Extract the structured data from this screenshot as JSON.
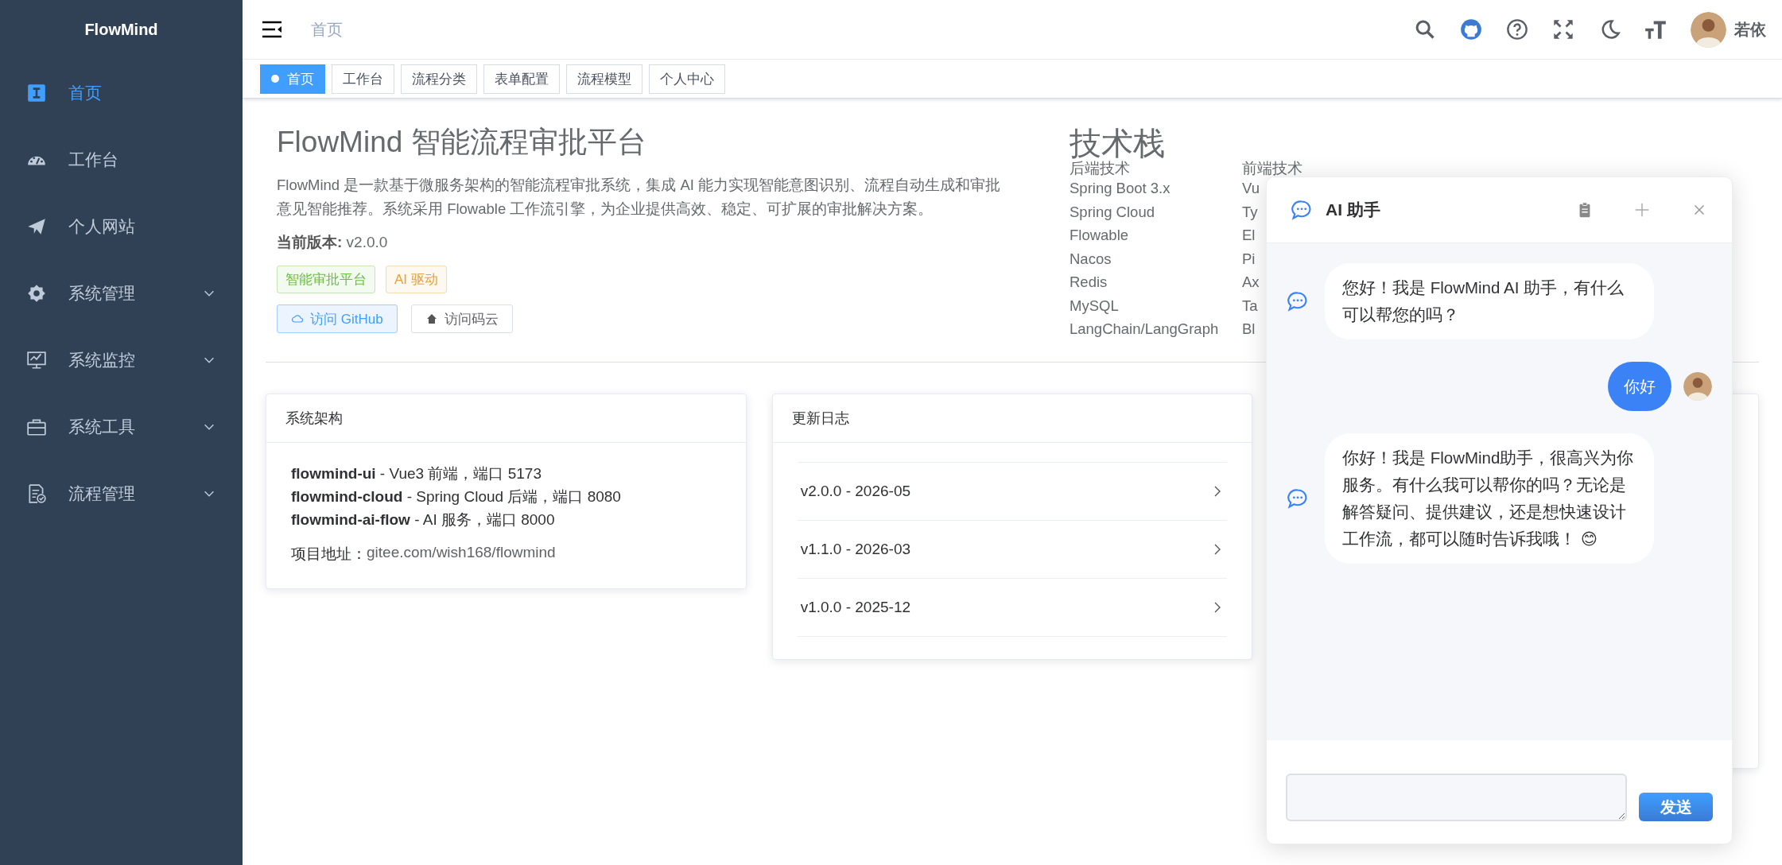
{
  "sidebar": {
    "logo": "FlowMind",
    "items": [
      {
        "label": "首页",
        "selected": true,
        "expandable": false
      },
      {
        "label": "工作台",
        "selected": false,
        "expandable": false
      },
      {
        "label": "个人网站",
        "selected": false,
        "expandable": false
      },
      {
        "label": "系统管理",
        "selected": false,
        "expandable": true
      },
      {
        "label": "系统监控",
        "selected": false,
        "expandable": true
      },
      {
        "label": "系统工具",
        "selected": false,
        "expandable": true
      },
      {
        "label": "流程管理",
        "selected": false,
        "expandable": true
      }
    ]
  },
  "header": {
    "breadcrumb": "首页",
    "user": "若依"
  },
  "tags": [
    {
      "label": "首页",
      "selected": true
    },
    {
      "label": "工作台",
      "selected": false
    },
    {
      "label": "流程分类",
      "selected": false
    },
    {
      "label": "表单配置",
      "selected": false
    },
    {
      "label": "流程模型",
      "selected": false
    },
    {
      "label": "个人中心",
      "selected": false
    }
  ],
  "intro": {
    "title": "FlowMind 智能流程审批平台",
    "description": "FlowMind 是一款基于微服务架构的智能流程审批系统，集成 AI 能力实现智能意图识别、流程自动生成和审批意见智能推荐。系统采用 Flowable 工作流引擎，为企业提供高效、稳定、可扩展的审批解决方案。",
    "version": "**当前版本:** v2.0.0",
    "tags": [
      {
        "label": "智能审批平台",
        "color": "#67c23a"
      },
      {
        "label": "AI 驱动",
        "color": "#e6a23c"
      }
    ],
    "buttons": [
      {
        "label": "访问 GitHub",
        "kind": "primary"
      },
      {
        "label": "访问码云",
        "kind": "default"
      }
    ]
  },
  "tech_stack": {
    "title": "技术栈",
    "columns": [
      {
        "heading": "后端技术",
        "items": [
          "Spring Boot 3.x",
          "Spring Cloud",
          "Flowable",
          "Nacos",
          "Redis",
          "MySQL",
          "LangChain/LangGraph"
        ]
      },
      {
        "heading": "前端技术",
        "items": [
          "Vu",
          "Ty",
          "El",
          "Pi",
          "Ax",
          "Ta",
          "Bl"
        ]
      }
    ]
  },
  "architecture": {
    "title": "系统架构",
    "lines": [
      "**flowmind-ui** - Vue3 前端，端口 5173",
      "**flowmind-cloud** - Spring Cloud 后端，端口 8080",
      "**flowmind-ai-flow** - AI 服务，端口 8000"
    ],
    "address_label": "项目地址：",
    "address": "gitee.com/wish168/flowmind"
  },
  "changelog": {
    "title": "更新日志",
    "entries": [
      "v2.0.0 - 2026-05",
      "v1.1.0 - 2026-03",
      "v1.0.0 - 2025-12"
    ]
  },
  "chat": {
    "title": "AI 助手",
    "messages": [
      {
        "kind": "assistant",
        "text": "您好！我是 FlowMind AI 助手，有什么可以帮您的吗？"
      },
      {
        "kind": "user",
        "text": "你好"
      },
      {
        "kind": "assistant",
        "text": "你好！我是 FlowMind助手，很高兴为你服务。有什么我可以帮你的吗？无论是解答疑问、提供建议，还是想快速设计工作流，都可以随时告诉我哦！ 😊"
      }
    ],
    "send": "发送"
  }
}
